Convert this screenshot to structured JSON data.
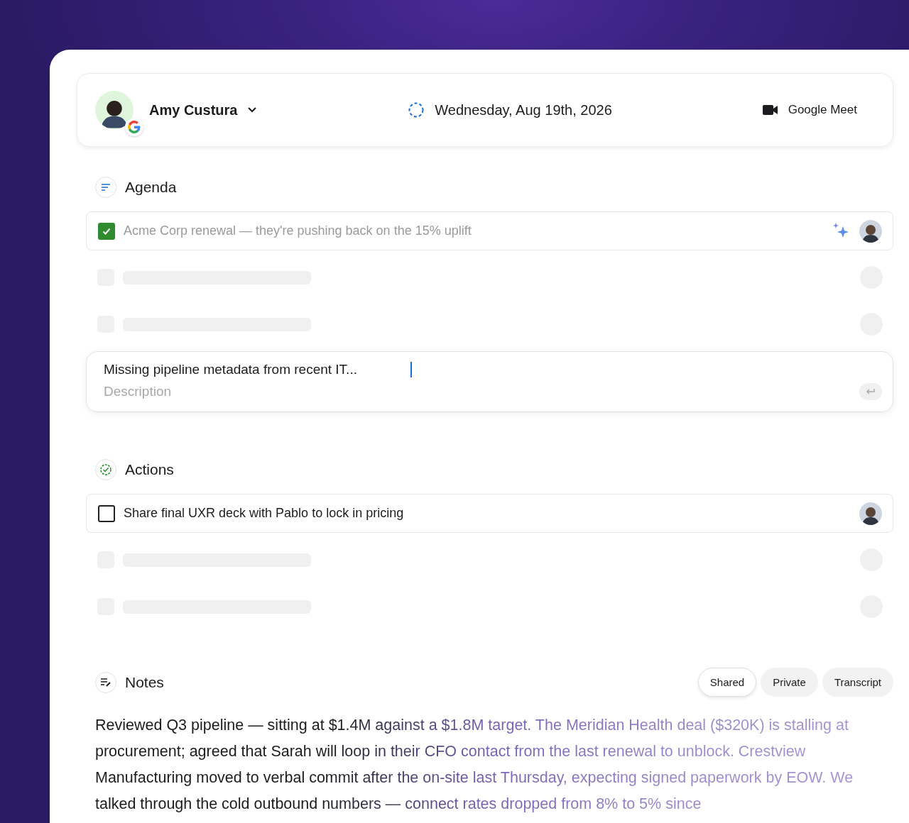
{
  "header": {
    "user": {
      "name": "Amy Custura"
    },
    "date": "Wednesday, Aug 19th, 2026",
    "meeting": "Google Meet"
  },
  "agenda": {
    "title": "Agenda",
    "items": [
      {
        "kind": "item",
        "text": "Acme Corp renewal — they're pushing back on the 15% uplift",
        "checked": true,
        "ai": true
      },
      {
        "kind": "skeleton"
      },
      {
        "kind": "skeleton"
      }
    ],
    "draft": {
      "value": "Missing pipeline metadata from recent IT...",
      "placeholder": "Description"
    }
  },
  "actions": {
    "title": "Actions",
    "items": [
      {
        "kind": "item",
        "text": "Share final UXR deck with Pablo to lock in pricing",
        "checked": false,
        "ai": false
      },
      {
        "kind": "skeleton"
      },
      {
        "kind": "skeleton"
      }
    ]
  },
  "notes": {
    "title": "Notes",
    "tabs": [
      {
        "label": "Shared",
        "selected": true
      },
      {
        "label": "Private",
        "selected": false
      },
      {
        "label": "Transcript",
        "selected": false
      }
    ],
    "text": "Reviewed Q3 pipeline — sitting at $1.4M against a $1.8M target. The Meridian Health deal ($320K) is stalling at procurement; agreed that Sarah will loop in their CFO contact from the last renewal to unblock. Crestview Manufacturing moved to verbal commit after the on-site last Thursday, expecting signed paperwork by EOW. We talked through the cold outbound numbers — connect rates dropped from 8% to 5% since"
  }
}
